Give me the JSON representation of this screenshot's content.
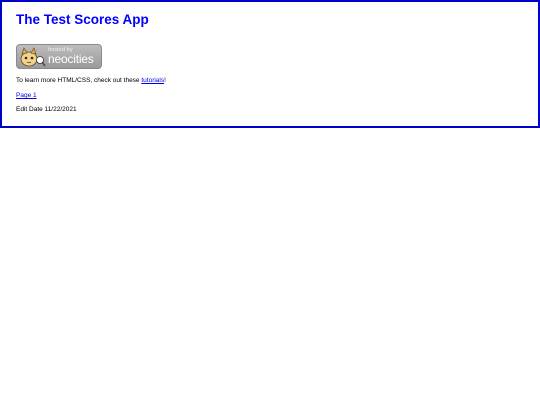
{
  "page": {
    "title": "The Test Scores App",
    "badge": {
      "hosted_by": "hosted by",
      "brand": "neocities"
    },
    "intro": {
      "prefix": "To learn more HTML/CSS, check out these ",
      "link": "tutorials",
      "suffix": "!"
    },
    "page_link": "Page 1",
    "edit_date": "Edit Date 11/22/2021"
  },
  "colors": {
    "border": "#0000cc",
    "title": "#0000ff",
    "link": "#0000ee"
  }
}
